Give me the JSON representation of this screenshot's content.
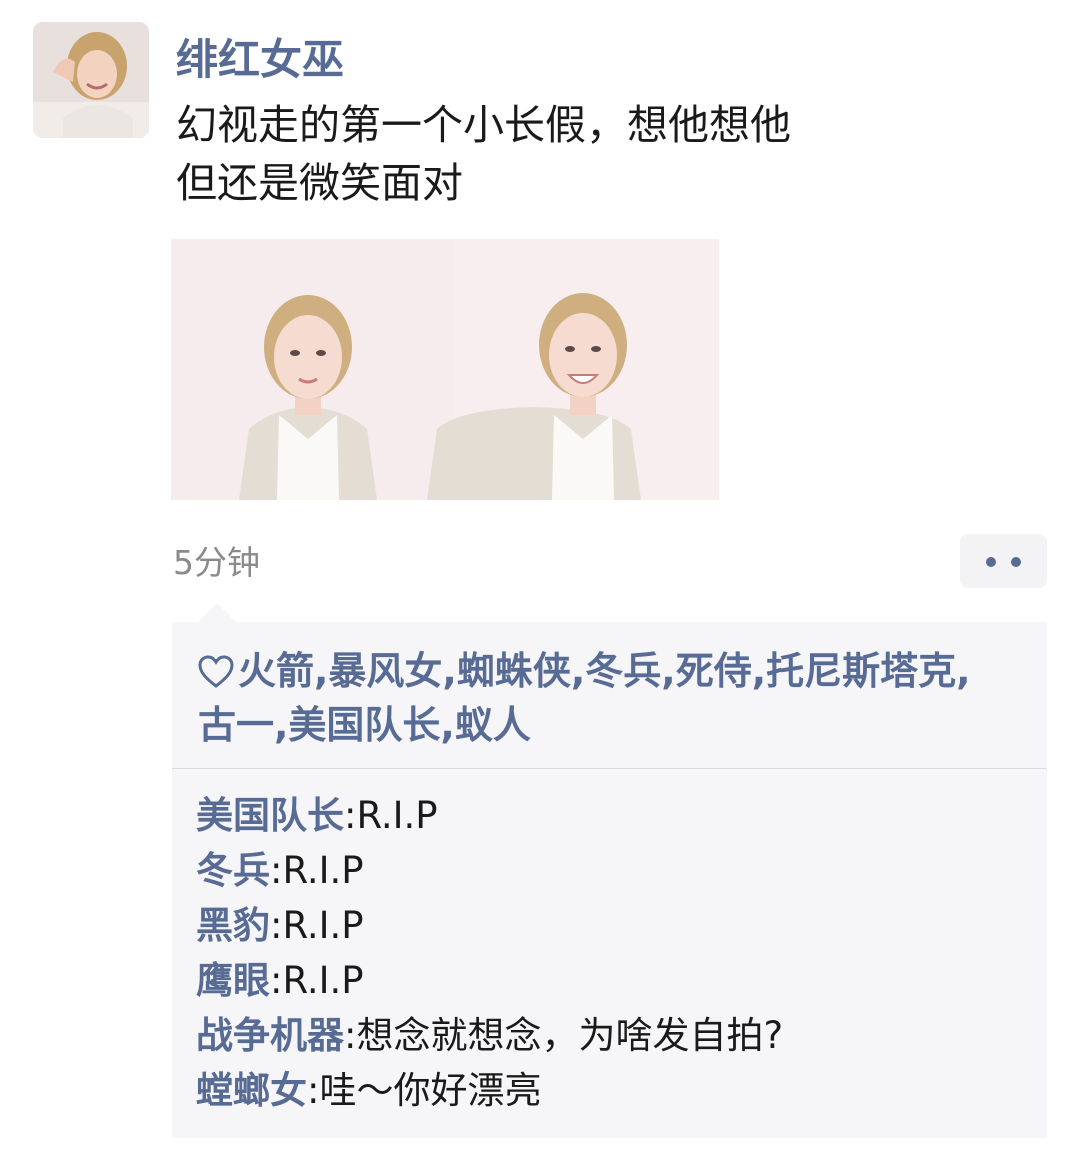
{
  "post": {
    "username": "绯红女巫",
    "content_lines": [
      "幻视走的第一个小长假，想他想他",
      "但还是微笑面对"
    ],
    "timestamp": "5分钟"
  },
  "likes": {
    "line1": "火箭,暴风女,蜘蛛侠,冬兵,死侍,托尼斯塔克,",
    "line2": "古一,美国队长,蚁人"
  },
  "comments": [
    {
      "author": "美国队长",
      "separator": ":",
      "text": "R.I.P"
    },
    {
      "author": "冬兵",
      "separator": ":",
      "text": "R.I.P"
    },
    {
      "author": "黑豹",
      "separator": ":",
      "text": "R.I.P"
    },
    {
      "author": "鹰眼",
      "separator": ":",
      "text": "R.I.P"
    },
    {
      "author": "战争机器",
      "separator": ":",
      "text": "想念就想念，为啥发自拍?"
    },
    {
      "author": "螳螂女",
      "separator": ":",
      "text": "哇～你好漂亮"
    }
  ],
  "colors": {
    "link": "#576b95",
    "text": "#1a1a1a",
    "timestamp": "#8a8a8a",
    "panel": "#f6f6f8"
  },
  "icons": [
    "heart-icon",
    "more-options-icon"
  ]
}
